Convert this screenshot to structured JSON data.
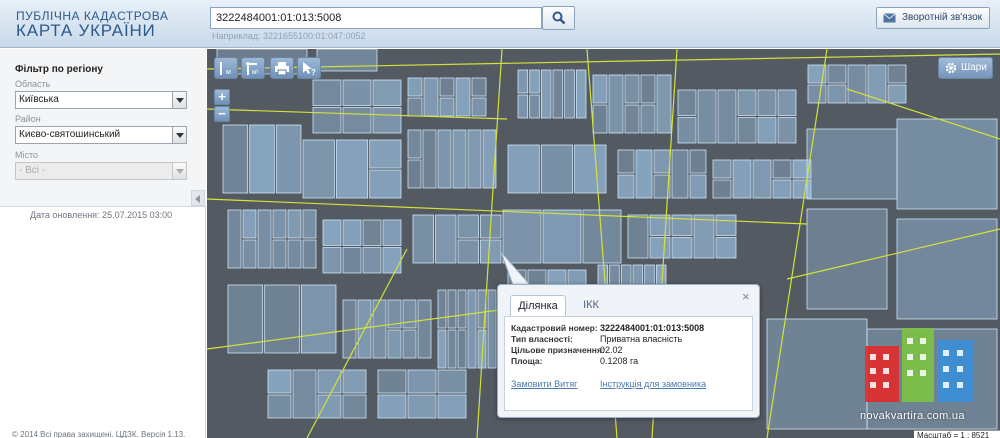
{
  "header": {
    "logo_line1": "ПУБЛІЧНА КАДАСТРОВА",
    "logo_line2": "КАРТА УКРАЇНИ",
    "search_value": "3222484001:01:013:5008",
    "search_hint": "Наприклад: 3221655100:01:047:0052",
    "feedback_label": "Зворотній зв'язок"
  },
  "sidebar": {
    "filter_title": "Фільтр по регіону",
    "region_label": "Область",
    "region_value": "Київська",
    "district_label": "Район",
    "district_value": "Києво-святошинський",
    "city_label": "Місто",
    "city_value": "- Всі -",
    "update_date": "Дата оновлення: 25.07.2015 03:00",
    "copyright": "© 2014 Всі права захищені. ЦДЗК. Версія 1.13."
  },
  "map": {
    "layers_label": "Шари",
    "zoom_in": "+",
    "zoom_out": "−",
    "scale": "Масштаб = 1 : 8521"
  },
  "popup": {
    "tab_active": "Ділянка",
    "tab_inactive": "ІКК",
    "close": "×",
    "rows": [
      {
        "label": "Кадастровий номер:",
        "value": "3222484001:01:013:5008"
      },
      {
        "label": "Тип власності:",
        "value": "Приватна власність"
      },
      {
        "label": "Цільове призначення:",
        "value": "02.02"
      },
      {
        "label": "Площа:",
        "value": "0.1208 га"
      }
    ],
    "link_extract": "Замовити Витяг",
    "link_instruction": "Інструкція для замовника"
  },
  "watermark": {
    "text": "novakvartira.com.ua"
  },
  "colors": {
    "map_bg": "#535a62",
    "parcel_fill": "#9ec4e6",
    "parcel_stroke": "#cfe4f7",
    "boundary": "#d4e23a",
    "link": "#4b78ad"
  }
}
